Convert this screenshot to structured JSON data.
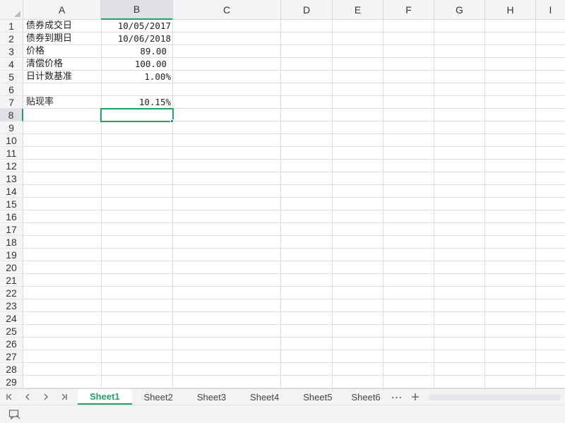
{
  "columns": [
    "A",
    "B",
    "C",
    "D",
    "E",
    "F",
    "G",
    "H",
    "I"
  ],
  "selected_column": "B",
  "rows": [
    "1",
    "2",
    "3",
    "4",
    "5",
    "6",
    "7",
    "8",
    "9",
    "10",
    "11",
    "12",
    "13",
    "14",
    "15",
    "16",
    "17",
    "18",
    "19",
    "20",
    "21",
    "22",
    "23",
    "24",
    "25",
    "26",
    "27",
    "28",
    "29"
  ],
  "selected_row": "8",
  "cells": {
    "A1": "债券成交日",
    "B1": "10/05/2017",
    "A2": "债券到期日",
    "B2": "10/06/2018",
    "A3": "价格",
    "B3": "89.00",
    "A4": "清偿价格",
    "B4": "100.00",
    "A5": "日计数基准",
    "B5": "1.00%",
    "A7": "贴现率",
    "B7": "10.15%"
  },
  "active_cell": "B8",
  "sheet_tabs": [
    "Sheet1",
    "Sheet2",
    "Sheet3",
    "Sheet4",
    "Sheet5",
    "Sheet6"
  ],
  "active_sheet": "Sheet1",
  "accent_color": "#21a366",
  "icons": {
    "nav_first": "first-sheet-icon",
    "nav_prev": "prev-sheet-icon",
    "nav_next": "next-sheet-icon",
    "nav_last": "last-sheet-icon",
    "more": "ellipsis-icon",
    "add": "plus-icon",
    "status": "comment-icon"
  }
}
